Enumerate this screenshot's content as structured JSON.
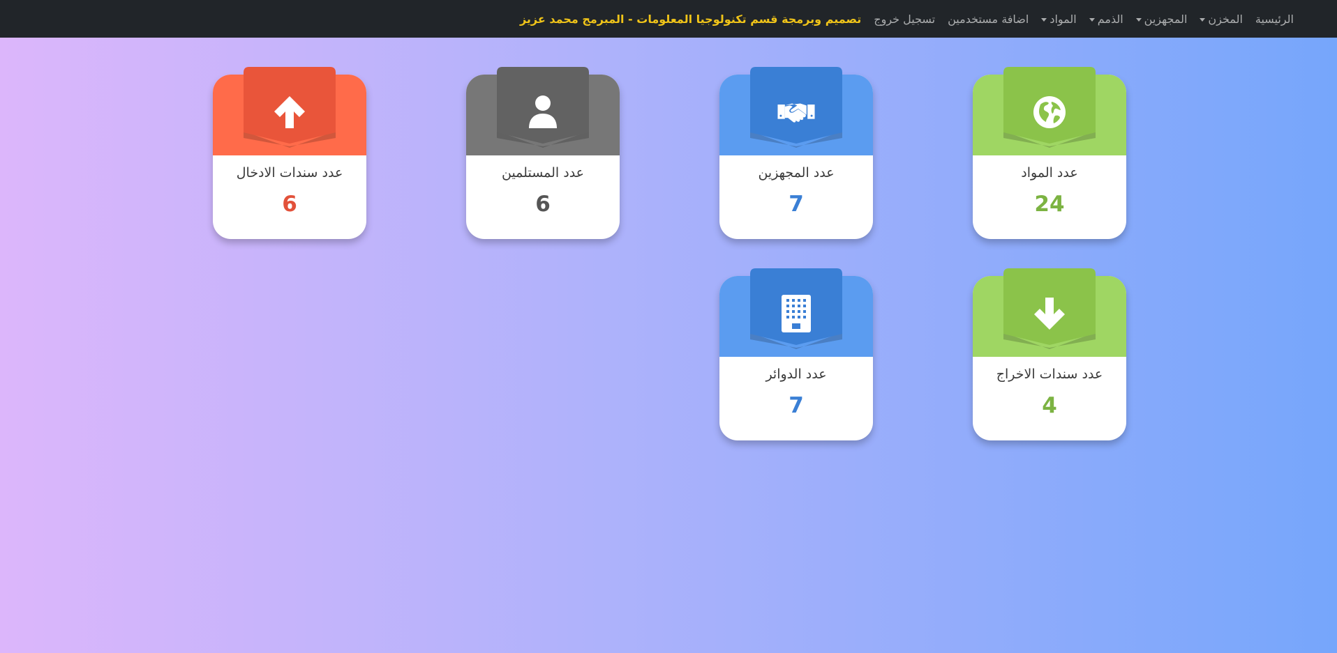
{
  "nav": {
    "items": [
      {
        "label": "الرئيسية",
        "dropdown": false
      },
      {
        "label": "المخزن",
        "dropdown": true
      },
      {
        "label": "المجهزين",
        "dropdown": true
      },
      {
        "label": "الذمم",
        "dropdown": true
      },
      {
        "label": "المواد",
        "dropdown": true
      },
      {
        "label": "اضافة مستخدمين",
        "dropdown": false
      },
      {
        "label": "تسجيل خروج",
        "dropdown": false
      }
    ],
    "brand": "تصميم وبرمجة قسم تكنولوجيا المعلومات - المبرمج محمد عزيز"
  },
  "cards": [
    {
      "title": "عدد المواد",
      "value": "24",
      "icon": "globe-icon",
      "color": "#9fd663",
      "ribbon": "#8bc34a",
      "valueColor": "#7cb342"
    },
    {
      "title": "عدد المجهزين",
      "value": "7",
      "icon": "handshake-icon",
      "color": "#5b9cf0",
      "ribbon": "#3a7fd5",
      "valueColor": "#3a7fd5"
    },
    {
      "title": "عدد المستلمين",
      "value": "6",
      "icon": "user-icon",
      "color": "#777777",
      "ribbon": "#626262",
      "valueColor": "#555555"
    },
    {
      "title": "عدد سندات الادخال",
      "value": "6",
      "icon": "arrow-up-icon",
      "color": "#ff6b4a",
      "ribbon": "#e9553a",
      "valueColor": "#e2513a"
    },
    {
      "title": "عدد سندات الاخراج",
      "value": "4",
      "icon": "arrow-down-icon",
      "color": "#9fd663",
      "ribbon": "#8bc34a",
      "valueColor": "#7cb342"
    },
    {
      "title": "عدد الدوائر",
      "value": "7",
      "icon": "building-icon",
      "color": "#5b9cf0",
      "ribbon": "#3a7fd5",
      "valueColor": "#3a7fd5"
    }
  ]
}
